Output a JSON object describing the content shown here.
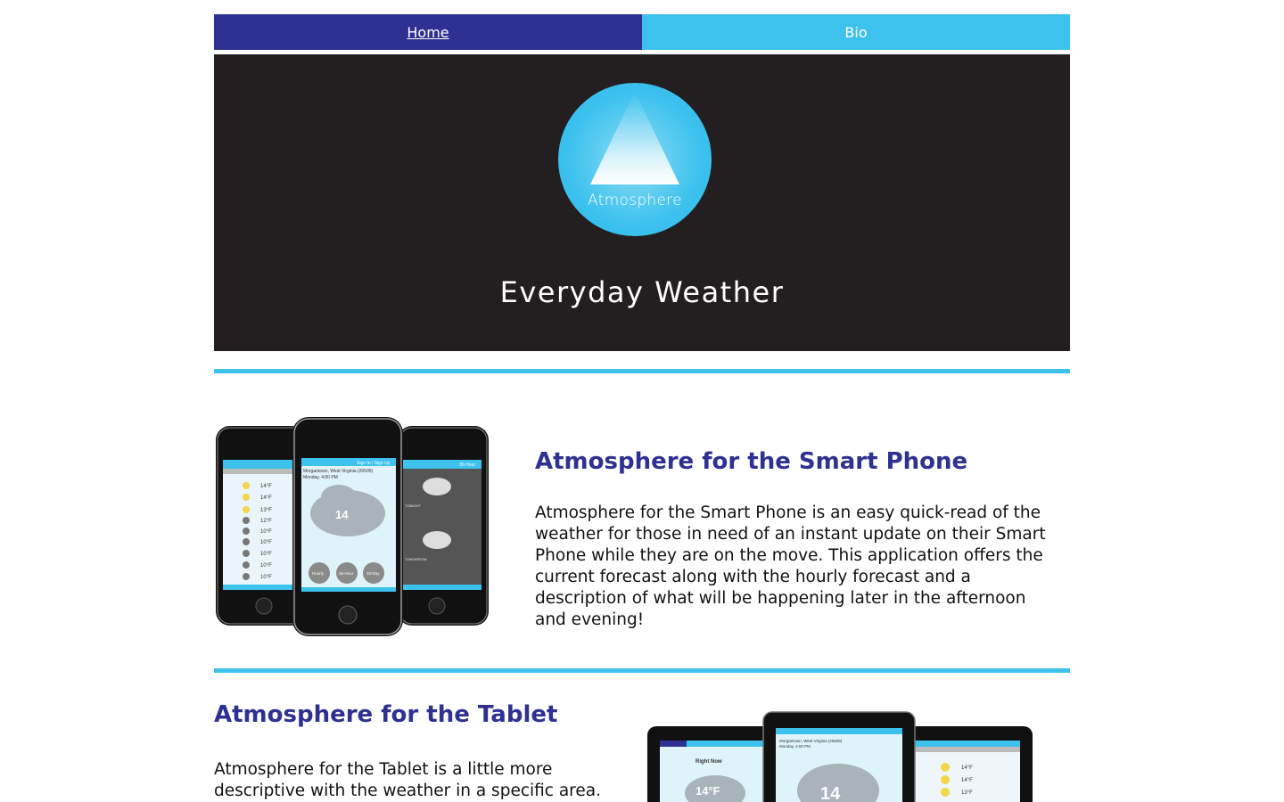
{
  "nav": {
    "home_label": "Home",
    "bio_label": "Bio"
  },
  "hero": {
    "logo_text": "Atmosphere",
    "title": "Everyday Weather"
  },
  "phone_section": {
    "title": "Atmosphere for the Smart Phone",
    "body": "Atmosphere for the Smart Phone is an easy quick-read of the weather for those in need of an instant update on their Smart Phone while they are on the move. This application offers the current forecast along with the hourly forecast and a description of what will be happening later in the afternoon and evening!"
  },
  "tablet_section": {
    "title": "Atmosphere for the Tablet",
    "body": "Atmosphere for the Tablet is a little more descriptive with the weather in a specific area."
  },
  "mockup_text": {
    "phone_center_location": "Morgantown, West Virginia (26505)",
    "phone_center_date": "Monday, 4:00 PM",
    "phone_center_temp": "14",
    "phone_btn_hourly": "Hourly",
    "phone_btn_36": "36-Hour",
    "phone_btn_10": "10-Day",
    "phone_signin": "Sign In | Sign Up",
    "phone_36_tab": "36-Hour",
    "phone_tonight": "TONIGHT",
    "phone_tomorrow": "TOMORROW",
    "phone_left_temps": [
      "14°F",
      "14°F",
      "13°F",
      "12°F",
      "10°F",
      "10°F",
      "10°F",
      "10°F",
      "10°F"
    ],
    "tablet_right_now": "Right Now",
    "tablet_left_temp": "14°F",
    "tablet_center_temp": "14",
    "tablet_center_location": "Morgantown, West Virginia (26505)",
    "tablet_center_date": "Monday, 4:00 PM",
    "tablet_right_temps": [
      "14°F",
      "14°F",
      "13°F"
    ]
  },
  "colors": {
    "navy": "#2e3192",
    "sky": "#3dc2ee",
    "hero_bg": "#231f20"
  }
}
